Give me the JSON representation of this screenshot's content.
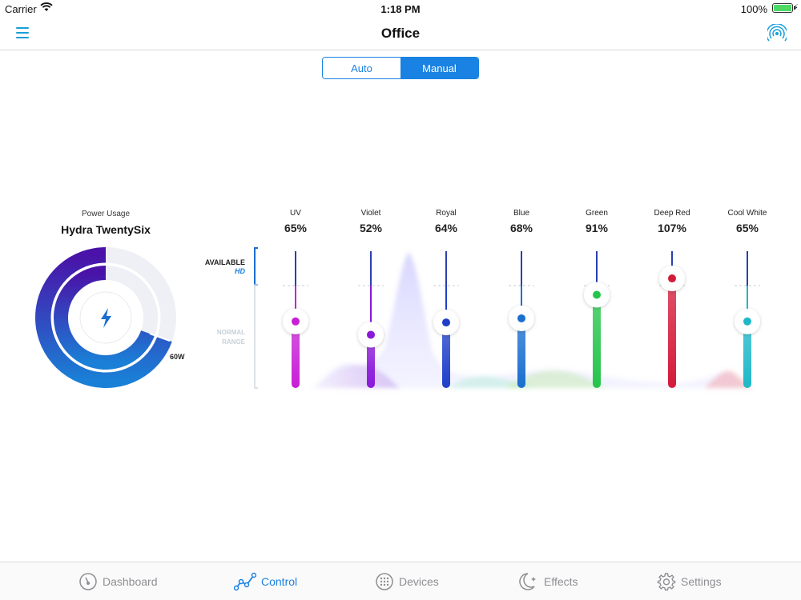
{
  "status_bar": {
    "carrier": "Carrier",
    "time": "1:18 PM",
    "battery": "100%"
  },
  "nav": {
    "title": "Office"
  },
  "mode": {
    "options": [
      "Auto",
      "Manual"
    ],
    "selected": "Manual"
  },
  "power": {
    "label": "Power Usage",
    "device": "Hydra TwentySix",
    "watts_label": "60W"
  },
  "range_labels": {
    "available": "AVAILABLE",
    "hd": "HD",
    "normal_line1": "NORMAL",
    "normal_line2": "RANGE"
  },
  "channels": [
    {
      "name": "UV",
      "value": "65%",
      "level": 65,
      "color": "#c81fd6"
    },
    {
      "name": "Violet",
      "value": "52%",
      "level": 52,
      "color": "#8a18d9"
    },
    {
      "name": "Royal",
      "value": "64%",
      "level": 64,
      "color": "#1f3fc8"
    },
    {
      "name": "Blue",
      "value": "68%",
      "level": 68,
      "color": "#1a6fd0"
    },
    {
      "name": "Green",
      "value": "91%",
      "level": 91,
      "color": "#25c44a"
    },
    {
      "name": "Deep Red",
      "value": "107%",
      "level": 107,
      "color": "#d41a3a"
    },
    {
      "name": "Cool White",
      "value": "65%",
      "level": 65,
      "color": "#1fb8c8"
    }
  ],
  "tabs": [
    {
      "label": "Dashboard",
      "icon": "dashboard-icon",
      "active": false
    },
    {
      "label": "Control",
      "icon": "control-icon",
      "active": true
    },
    {
      "label": "Devices",
      "icon": "devices-icon",
      "active": false
    },
    {
      "label": "Effects",
      "icon": "effects-icon",
      "active": false
    },
    {
      "label": "Settings",
      "icon": "settings-icon",
      "active": false
    }
  ],
  "colors": {
    "accent": "#1a82e2",
    "nav_icon": "#1a9ed8",
    "donut_dark": "#4a1fb0",
    "donut_light": "#1a82e2",
    "donut_track": "#eef0f5"
  }
}
